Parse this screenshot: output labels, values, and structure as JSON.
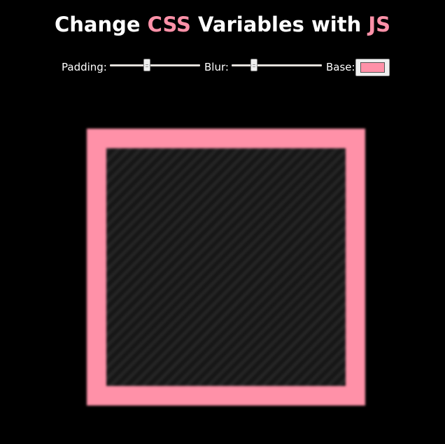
{
  "title": {
    "part1": "Change ",
    "highlight1": "CSS",
    "part2": " Variables with ",
    "highlight2": "JS"
  },
  "controls": {
    "padding": {
      "label": "Padding:",
      "value_fraction": 0.4
    },
    "blur": {
      "label": "Blur:",
      "value_fraction": 0.23
    },
    "base": {
      "label": "Base:",
      "value": "#ff91a8"
    }
  },
  "colors": {
    "background": "#000000",
    "accent": "#ff91a8",
    "inner_panel": "#1c1c1c"
  }
}
